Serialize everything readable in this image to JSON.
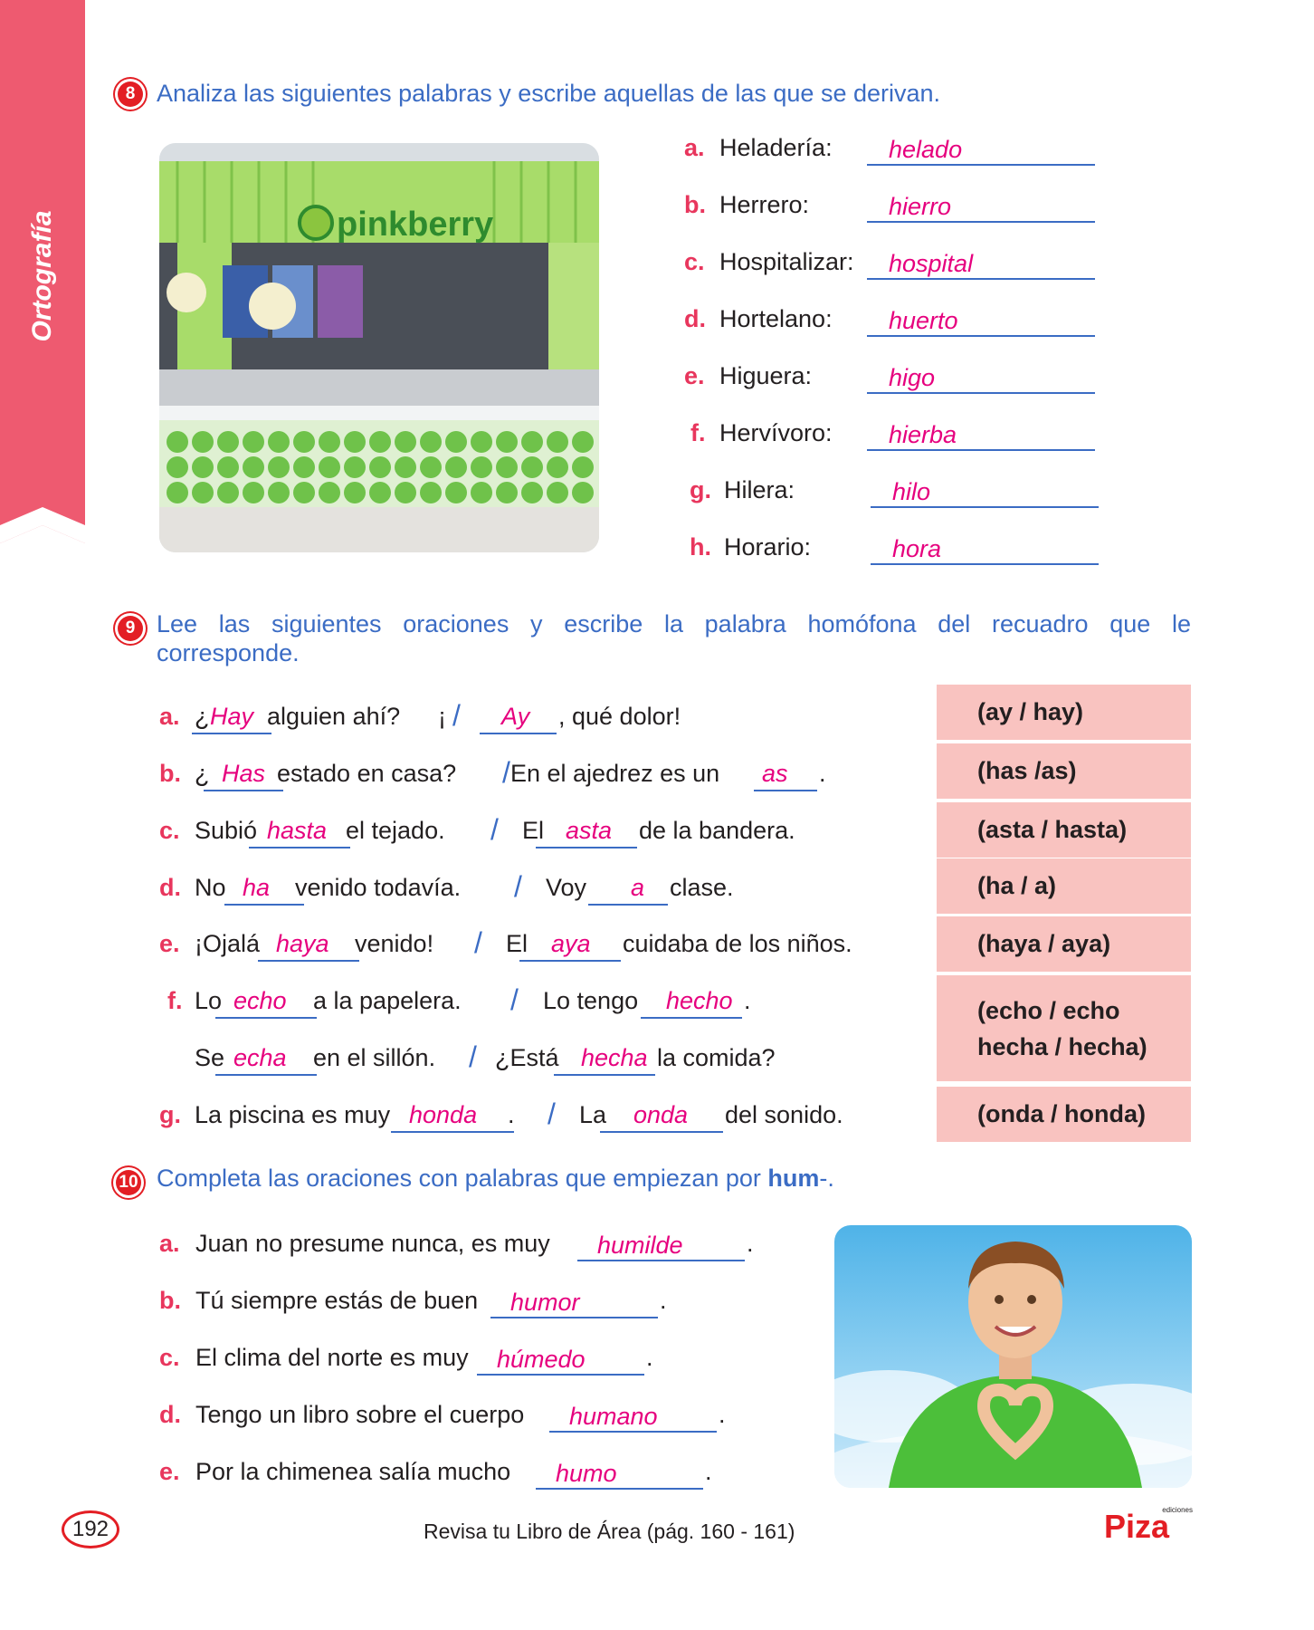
{
  "side_tab": "Ortografía",
  "exercise8": {
    "number": "8",
    "instruction": "Analiza las siguientes palabras y escribe aquellas de las que se derivan.",
    "photo_sign": "pinkberry",
    "items": [
      {
        "letter": "a.",
        "word": "Heladería:",
        "answer": "helado"
      },
      {
        "letter": "b.",
        "word": "Herrero:",
        "answer": "hierro"
      },
      {
        "letter": "c.",
        "word": "Hospitalizar:",
        "answer": "hospital"
      },
      {
        "letter": "d.",
        "word": "Hortelano:",
        "answer": "huerto"
      },
      {
        "letter": "e.",
        "word": "Higuera:",
        "answer": "higo"
      },
      {
        "letter": "f.",
        "word": "Hervívoro:",
        "answer": "hierba"
      },
      {
        "letter": "g.",
        "word": "Hilera:",
        "answer": "hilo"
      },
      {
        "letter": "h.",
        "word": "Horario:",
        "answer": "hora"
      }
    ]
  },
  "exercise9": {
    "number": "9",
    "instruction_line1": "Lee las siguientes oraciones y escribe la palabra homófona del recuadro que le",
    "instruction_line2": "corresponde.",
    "slash": "/",
    "rows": {
      "a": {
        "letter": "a.",
        "p1": "¿",
        "ans1": "Hay",
        "p2": "alguien ahí?",
        "p3": "¡",
        "ans2": "Ay",
        "p4": ", qué dolor!"
      },
      "b": {
        "letter": "b.",
        "p1": "¿",
        "ans1": "Has",
        "p2": "estado en casa?",
        "p3": "En el ajedrez es un",
        "ans2": "as",
        "p4": "."
      },
      "c": {
        "letter": "c.",
        "p1": "Subió",
        "ans1": "hasta",
        "p2": "el tejado.",
        "p3": "El",
        "ans2": "asta",
        "p4": "de la bandera."
      },
      "d": {
        "letter": "d.",
        "p1": "No",
        "ans1": "ha",
        "p2": "venido todavía.",
        "p3": "Voy",
        "ans2": "a",
        "p4": "clase."
      },
      "e": {
        "letter": "e.",
        "p1": "¡Ojalá",
        "ans1": "haya",
        "p2": "venido!",
        "p3": "El",
        "ans2": "aya",
        "p4": "cuidaba de los niños."
      },
      "f1": {
        "letter": "f.",
        "p1": "Lo",
        "ans1": "echo",
        "p2": "a la papelera.",
        "p3": "Lo tengo",
        "ans2": "hecho",
        "p4": "."
      },
      "f2": {
        "p1": "Se",
        "ans1": "echa",
        "p2": "en el sillón.",
        "p3": "¿Está",
        "ans2": "hecha",
        "p4": "la comida?"
      },
      "g": {
        "letter": "g.",
        "p1": "La piscina es muy",
        "ans1": "honda",
        "p2": ".",
        "p3": "La",
        "ans2": "onda",
        "p4": "del sonido."
      }
    },
    "boxes": [
      "(ay / hay)",
      "(has /as)",
      "(asta / hasta)",
      "(ha / a)",
      "(haya / aya)",
      "(echo / echo",
      "hecha / hecha)",
      "(onda / honda)"
    ]
  },
  "exercise10": {
    "number": "10",
    "instruction_pre": "Completa las oraciones con palabras que empiezan por",
    "instruction_bold": "hum",
    "instruction_post": "-.",
    "items": [
      {
        "letter": "a.",
        "text": "Juan no presume nunca, es muy",
        "answer": "humilde",
        "end": "."
      },
      {
        "letter": "b.",
        "text": "Tú siempre estás de buen",
        "answer": "humor",
        "end": "."
      },
      {
        "letter": "c.",
        "text": "El clima del norte es muy",
        "answer": "húmedo",
        "end": "."
      },
      {
        "letter": "d.",
        "text": "Tengo un libro sobre el cuerpo",
        "answer": "humano",
        "end": "."
      },
      {
        "letter": "e.",
        "text": "Por la chimenea salía mucho",
        "answer": "humo",
        "end": "."
      }
    ]
  },
  "footer": {
    "page_number": "192",
    "text": "Revisa tu Libro de Área (pág. 160 - 161)",
    "brand": "Piza",
    "brand_small": "ediciones"
  },
  "colors": {
    "ribbon": "#ee5a70",
    "instruction": "#3b6cc4",
    "answer": "#e6007e",
    "letter": "#e8365d",
    "box": "#f9c3c0"
  }
}
